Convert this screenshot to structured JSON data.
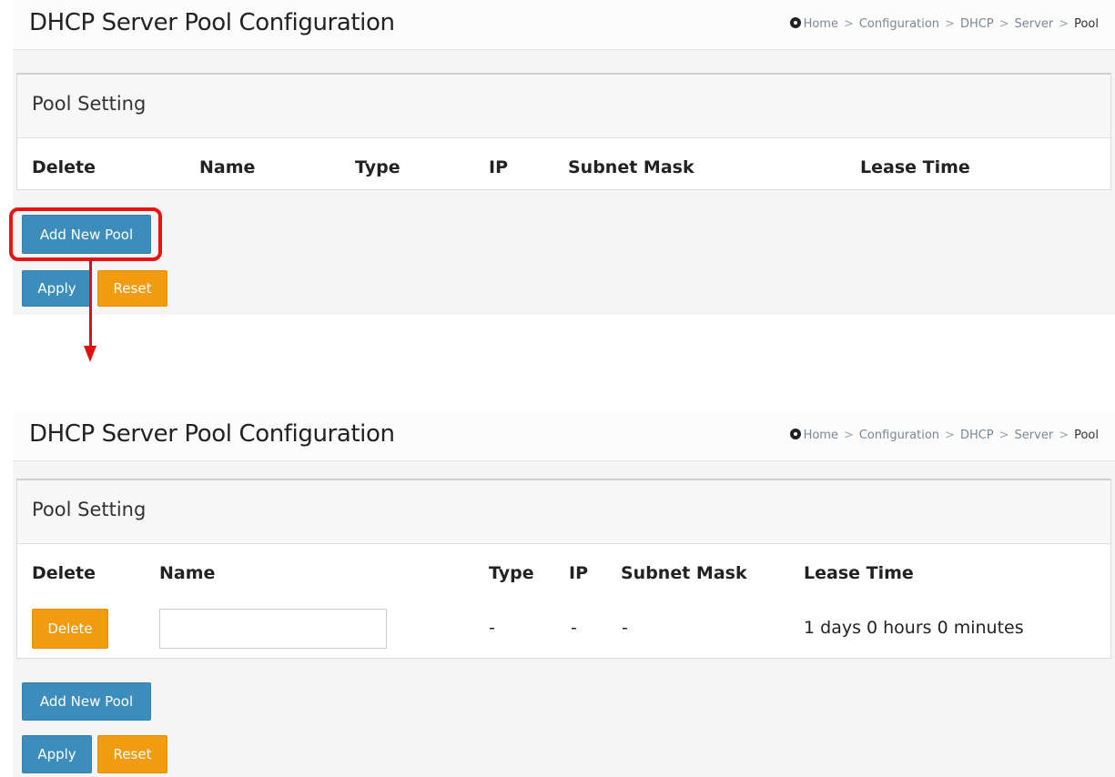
{
  "top_view": {
    "page_title": "DHCP Server Pool Configuration",
    "breadcrumb": [
      "Home",
      "Configuration",
      "DHCP",
      "Server",
      "Pool"
    ],
    "breadcrumb_separator": ">",
    "section_title": "Pool Setting",
    "columns": [
      "Delete",
      "Name",
      "Type",
      "IP",
      "Subnet Mask",
      "Lease Time"
    ],
    "add_button": "Add New Pool",
    "apply_button": "Apply",
    "reset_button": "Reset"
  },
  "bottom_view": {
    "page_title": "DHCP Server Pool Configuration",
    "breadcrumb": [
      "Home",
      "Configuration",
      "DHCP",
      "Server",
      "Pool"
    ],
    "breadcrumb_separator": ">",
    "section_title": "Pool Setting",
    "columns": [
      "Delete",
      "Name",
      "Type",
      "IP",
      "Subnet Mask",
      "Lease Time"
    ],
    "row": {
      "delete_button": "Delete",
      "name_value": "",
      "type": "-",
      "ip": "-",
      "subnet_mask": "-",
      "lease_time": "1 days 0 hours 0 minutes"
    },
    "add_button": "Add New Pool",
    "apply_button": "Apply",
    "reset_button": "Reset"
  },
  "annotation": {
    "highlight_color": "#ee1111"
  },
  "colors": {
    "primary_button": "#3c8dbc",
    "warning_button": "#f39c12"
  },
  "icons": {
    "home": "dashboard-icon"
  }
}
